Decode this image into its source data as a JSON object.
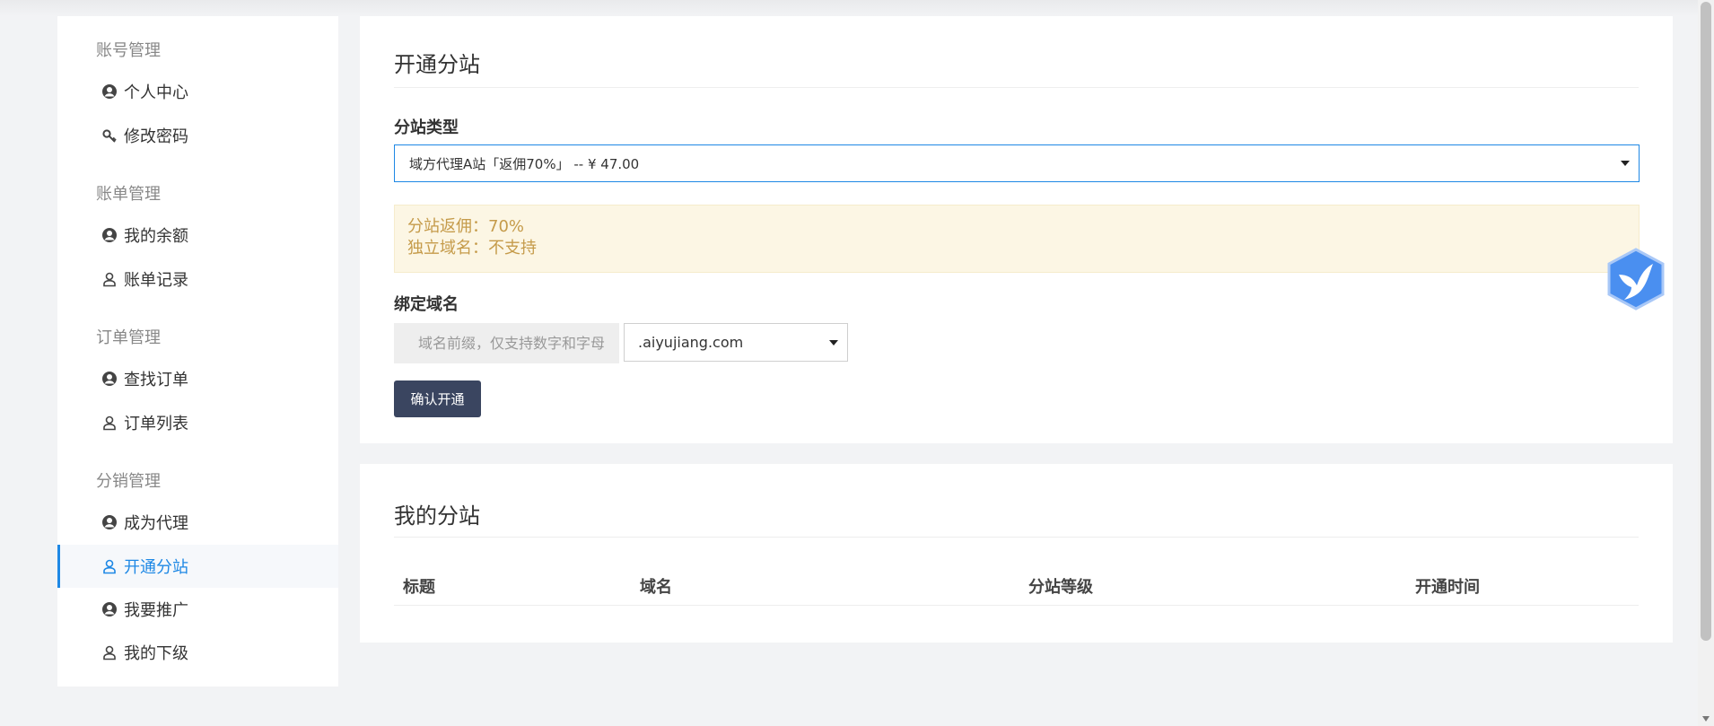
{
  "sidebar": {
    "groups": [
      {
        "title": "账号管理",
        "items": [
          {
            "label": "个人中心",
            "icon": "user-circle-icon"
          },
          {
            "label": "修改密码",
            "icon": "key-icon"
          }
        ]
      },
      {
        "title": "账单管理",
        "items": [
          {
            "label": "我的余额",
            "icon": "user-circle-icon"
          },
          {
            "label": "账单记录",
            "icon": "user-outline-icon"
          }
        ]
      },
      {
        "title": "订单管理",
        "items": [
          {
            "label": "查找订单",
            "icon": "user-circle-icon"
          },
          {
            "label": "订单列表",
            "icon": "user-outline-icon"
          }
        ]
      },
      {
        "title": "分销管理",
        "items": [
          {
            "label": "成为代理",
            "icon": "user-circle-icon"
          },
          {
            "label": "开通分站",
            "icon": "user-outline-icon",
            "active": true
          },
          {
            "label": "我要推广",
            "icon": "user-circle-icon"
          },
          {
            "label": "我的下级",
            "icon": "user-outline-icon"
          }
        ]
      }
    ]
  },
  "open_site": {
    "title": "开通分站",
    "type_label": "分站类型",
    "type_selected": "域方代理A站「返佣70%」 -- ¥ 47.00",
    "notice": {
      "commission": "分站返佣：70%",
      "domain": "独立域名：不支持"
    },
    "domain_label": "绑定域名",
    "domain_placeholder": "域名前缀，仅支持数字和字母",
    "domain_suffix": ".aiyujiang.com",
    "submit_label": "确认开通"
  },
  "my_sites": {
    "title": "我的分站",
    "columns": [
      "标题",
      "域名",
      "分站等级",
      "开通时间"
    ]
  },
  "colors": {
    "accent": "#1e88e5",
    "button": "#3a4560",
    "notice_bg": "#fcf6e4",
    "notice_text": "#c59b4a"
  }
}
